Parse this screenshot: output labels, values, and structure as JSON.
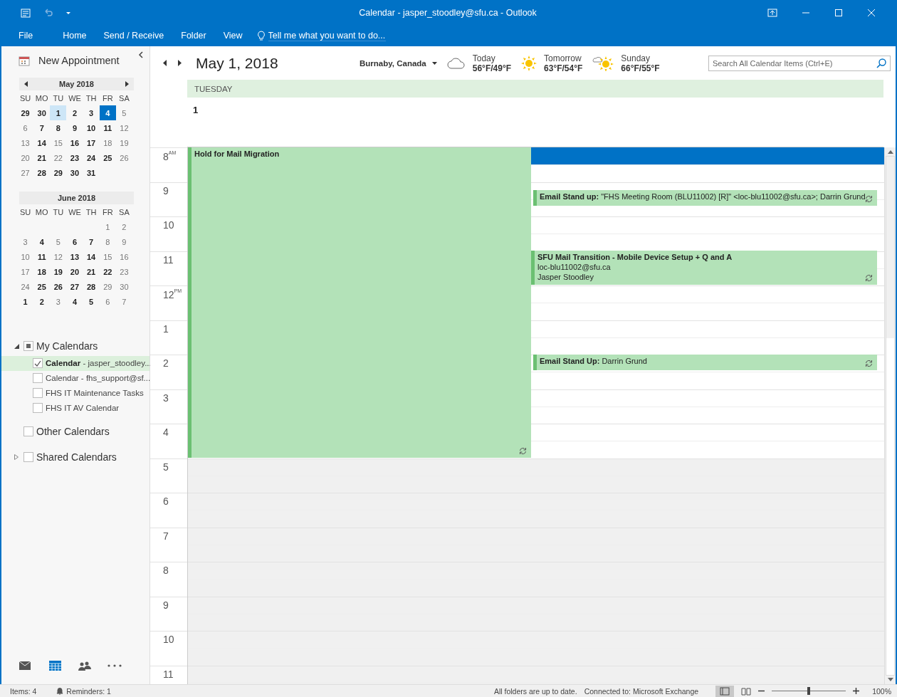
{
  "window": {
    "title": "Calendar - jasper_stoodley@sfu.ca - Outlook"
  },
  "ribbon_tabs": [
    {
      "label": "File",
      "selected": false
    },
    {
      "label": "Home",
      "selected": false
    },
    {
      "label": "Send / Receive",
      "selected": false
    },
    {
      "label": "Folder",
      "selected": false
    },
    {
      "label": "View",
      "selected": false
    }
  ],
  "tell_me": {
    "placeholder": "Tell me what you want to do..."
  },
  "sidebar": {
    "new_appointment": "New Appointment",
    "months": [
      {
        "title": "May 2018",
        "nav": true,
        "weekdays": [
          "SU",
          "MO",
          "TU",
          "WE",
          "TH",
          "FR",
          "SA"
        ],
        "days": [
          {
            "day": "29",
            "kind": "busy"
          },
          {
            "day": "30",
            "kind": "busy"
          },
          {
            "day": "1",
            "kind": "selected"
          },
          {
            "day": "2",
            "kind": "busy"
          },
          {
            "day": "3",
            "kind": "busy"
          },
          {
            "day": "4",
            "kind": "today"
          },
          {
            "day": "5",
            "kind": "free"
          },
          {
            "day": "6",
            "kind": "free"
          },
          {
            "day": "7",
            "kind": "busy"
          },
          {
            "day": "8",
            "kind": "busy"
          },
          {
            "day": "9",
            "kind": "busy"
          },
          {
            "day": "10",
            "kind": "busy"
          },
          {
            "day": "11",
            "kind": "busy"
          },
          {
            "day": "12",
            "kind": "free"
          },
          {
            "day": "13",
            "kind": "free"
          },
          {
            "day": "14",
            "kind": "busy"
          },
          {
            "day": "15",
            "kind": "free"
          },
          {
            "day": "16",
            "kind": "busy"
          },
          {
            "day": "17",
            "kind": "busy"
          },
          {
            "day": "18",
            "kind": "free"
          },
          {
            "day": "19",
            "kind": "free"
          },
          {
            "day": "20",
            "kind": "free"
          },
          {
            "day": "21",
            "kind": "busy"
          },
          {
            "day": "22",
            "kind": "free"
          },
          {
            "day": "23",
            "kind": "busy"
          },
          {
            "day": "24",
            "kind": "busy"
          },
          {
            "day": "25",
            "kind": "busy"
          },
          {
            "day": "26",
            "kind": "free"
          },
          {
            "day": "27",
            "kind": "free"
          },
          {
            "day": "28",
            "kind": "busy"
          },
          {
            "day": "29",
            "kind": "busy"
          },
          {
            "day": "30",
            "kind": "busy"
          },
          {
            "day": "31",
            "kind": "busy"
          }
        ]
      },
      {
        "title": "June 2018",
        "nav": false,
        "weekdays": [
          "SU",
          "MO",
          "TU",
          "WE",
          "TH",
          "FR",
          "SA"
        ],
        "days": [
          {
            "kind": "empty"
          },
          {
            "kind": "empty"
          },
          {
            "kind": "empty"
          },
          {
            "kind": "empty"
          },
          {
            "kind": "empty"
          },
          {
            "day": "1",
            "kind": "free"
          },
          {
            "day": "2",
            "kind": "free"
          },
          {
            "day": "3",
            "kind": "free"
          },
          {
            "day": "4",
            "kind": "busy"
          },
          {
            "day": "5",
            "kind": "free"
          },
          {
            "day": "6",
            "kind": "busy"
          },
          {
            "day": "7",
            "kind": "busy"
          },
          {
            "day": "8",
            "kind": "free"
          },
          {
            "day": "9",
            "kind": "free"
          },
          {
            "day": "10",
            "kind": "free"
          },
          {
            "day": "11",
            "kind": "busy"
          },
          {
            "day": "12",
            "kind": "free"
          },
          {
            "day": "13",
            "kind": "busy"
          },
          {
            "day": "14",
            "kind": "busy"
          },
          {
            "day": "15",
            "kind": "free"
          },
          {
            "day": "16",
            "kind": "free"
          },
          {
            "day": "17",
            "kind": "free"
          },
          {
            "day": "18",
            "kind": "busy"
          },
          {
            "day": "19",
            "kind": "busy"
          },
          {
            "day": "20",
            "kind": "busy"
          },
          {
            "day": "21",
            "kind": "busy"
          },
          {
            "day": "22",
            "kind": "busy"
          },
          {
            "day": "23",
            "kind": "free"
          },
          {
            "day": "24",
            "kind": "free"
          },
          {
            "day": "25",
            "kind": "busy"
          },
          {
            "day": "26",
            "kind": "busy"
          },
          {
            "day": "27",
            "kind": "busy"
          },
          {
            "day": "28",
            "kind": "busy"
          },
          {
            "day": "29",
            "kind": "free"
          },
          {
            "day": "30",
            "kind": "free"
          },
          {
            "day": "1",
            "kind": "busy"
          },
          {
            "day": "2",
            "kind": "busy"
          },
          {
            "day": "3",
            "kind": "free"
          },
          {
            "day": "4",
            "kind": "busy"
          },
          {
            "day": "5",
            "kind": "busy"
          },
          {
            "day": "6",
            "kind": "free"
          },
          {
            "day": "7",
            "kind": "free"
          }
        ]
      }
    ],
    "groups": [
      {
        "name": "My Calendars",
        "expanded": true,
        "checked": true,
        "items": [
          {
            "label": "**Calendar** - jasper_stoodley...",
            "checked": true,
            "selected": true
          },
          {
            "label": "Calendar - fhs_support@sf...",
            "checked": false,
            "selected": false
          },
          {
            "label": "FHS IT Maintenance Tasks",
            "checked": false,
            "selected": false
          },
          {
            "label": "FHS IT AV Calendar",
            "checked": false,
            "selected": false
          }
        ]
      },
      {
        "name": "Other Calendars",
        "checked": false
      },
      {
        "name": "Shared Calendars",
        "expanded": false,
        "checked": false
      }
    ],
    "nav": [
      {
        "kind": "mail",
        "selected": false
      },
      {
        "kind": "calendar",
        "selected": true
      },
      {
        "kind": "people",
        "selected": false
      },
      {
        "kind": "more",
        "selected": false
      }
    ]
  },
  "header": {
    "date": "May 1, 2018",
    "location": "Burnaby, Canada",
    "weather": [
      {
        "day": "Today",
        "temps": "56°F/49°F",
        "kind": "cloudy"
      },
      {
        "day": "Tomorrow",
        "temps": "63°F/54°F",
        "kind": "sunny"
      },
      {
        "day": "Sunday",
        "temps": "66°F/55°F",
        "kind": "partly-sunny"
      }
    ],
    "search": {
      "placeholder": "Search All Calendar Items (Ctrl+E)"
    }
  },
  "day": {
    "weekday": "TUESDAY",
    "number": "1",
    "selected_slot": true,
    "hours": [
      {
        "label": "8$^{AM}$",
        "work": true
      },
      {
        "label": "9",
        "work": true
      },
      {
        "label": "10",
        "work": true
      },
      {
        "label": "11",
        "work": true
      },
      {
        "label": "12$^{PM}$",
        "work": true
      },
      {
        "label": "1",
        "work": true
      },
      {
        "label": "2",
        "work": true
      },
      {
        "label": "3",
        "work": true
      },
      {
        "label": "4",
        "work": true
      },
      {
        "label": "5",
        "work": false
      },
      {
        "label": "6",
        "work": false
      },
      {
        "label": "7",
        "work": false
      },
      {
        "label": "8",
        "work": false
      },
      {
        "label": "9",
        "work": false
      },
      {
        "label": "10",
        "work": false
      },
      {
        "label": "11",
        "work": false
      }
    ],
    "events": [
      {
        "lines": [
          "**Hold for Mail Migration**"
        ],
        "recurring": true
      },
      {
        "lines": [
          "**Email Stand up:** \"FHS Meeting Room (BLU11002) [R]\" <loc-blu11002@sfu.ca>; Darrin Grund"
        ],
        "recurring": true
      },
      {
        "lines": [
          "**SFU Mail Transition - Mobile Device Setup + Q and A**",
          "loc-blu11002@sfu.ca",
          "Jasper Stoodley"
        ],
        "recurring": true
      },
      {
        "lines": [
          "**Email Stand Up:** Darrin Grund"
        ],
        "recurring": true
      }
    ]
  },
  "status_bar": {
    "items": "Items: 4",
    "reminders": "Reminders: 1",
    "sync": "All folders are up to date.",
    "connection": "Connected to: Microsoft Exchange",
    "zoom": {
      "level": 0.5,
      "label": "100%"
    }
  }
}
